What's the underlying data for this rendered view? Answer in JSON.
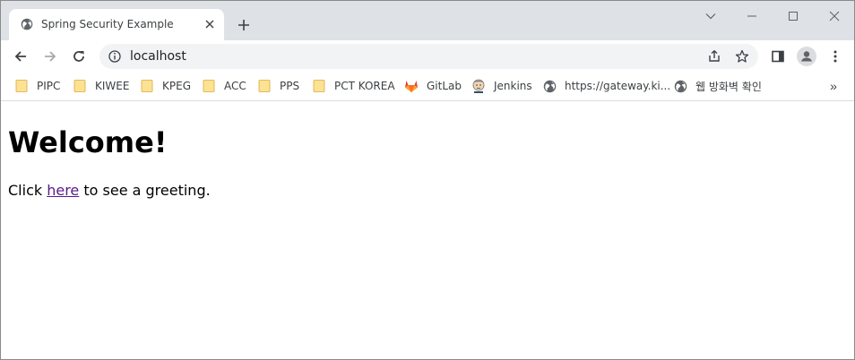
{
  "tab": {
    "title": "Spring Security Example",
    "close_glyph": "✕",
    "favicon": "globe-icon"
  },
  "window_controls": {
    "tab_search": "chevron-down-icon",
    "minimize": "minimize-icon",
    "maximize": "maximize-icon",
    "close": "close-icon"
  },
  "toolbar": {
    "url": "localhost",
    "back": "back-arrow-icon",
    "forward": "forward-arrow-icon",
    "reload": "reload-icon",
    "share": "share-icon",
    "bookmark_star": "star-icon",
    "side_panel": "side-panel-icon",
    "profile": "profile-icon",
    "menu": "kebab-menu-icon"
  },
  "bookmarks": {
    "items": [
      {
        "label": "PIPC",
        "icon": "folder-icon"
      },
      {
        "label": "KIWEE",
        "icon": "folder-icon"
      },
      {
        "label": "KPEG",
        "icon": "folder-icon"
      },
      {
        "label": "ACC",
        "icon": "folder-icon"
      },
      {
        "label": "PPS",
        "icon": "folder-icon"
      },
      {
        "label": "PCT KOREA",
        "icon": "folder-icon"
      },
      {
        "label": "GitLab",
        "icon": "gitlab-icon"
      },
      {
        "label": "Jenkins",
        "icon": "jenkins-icon"
      },
      {
        "label": "https://gateway.ki...",
        "icon": "globe-icon"
      },
      {
        "label": "웹 방화벽 확인",
        "icon": "globe-icon"
      }
    ],
    "more_glyph": "»"
  },
  "page": {
    "heading": "Welcome!",
    "para_before": "Click ",
    "link_text": "here",
    "para_after": " to see a greeting."
  },
  "colors": {
    "tabstrip_bg": "#dee1e6",
    "omnibox_bg": "#f1f3f4",
    "folder_fill": "#fde293",
    "folder_stroke": "#d9a93b",
    "gitlab": "#e24329",
    "link_visited": "#551a8b"
  }
}
